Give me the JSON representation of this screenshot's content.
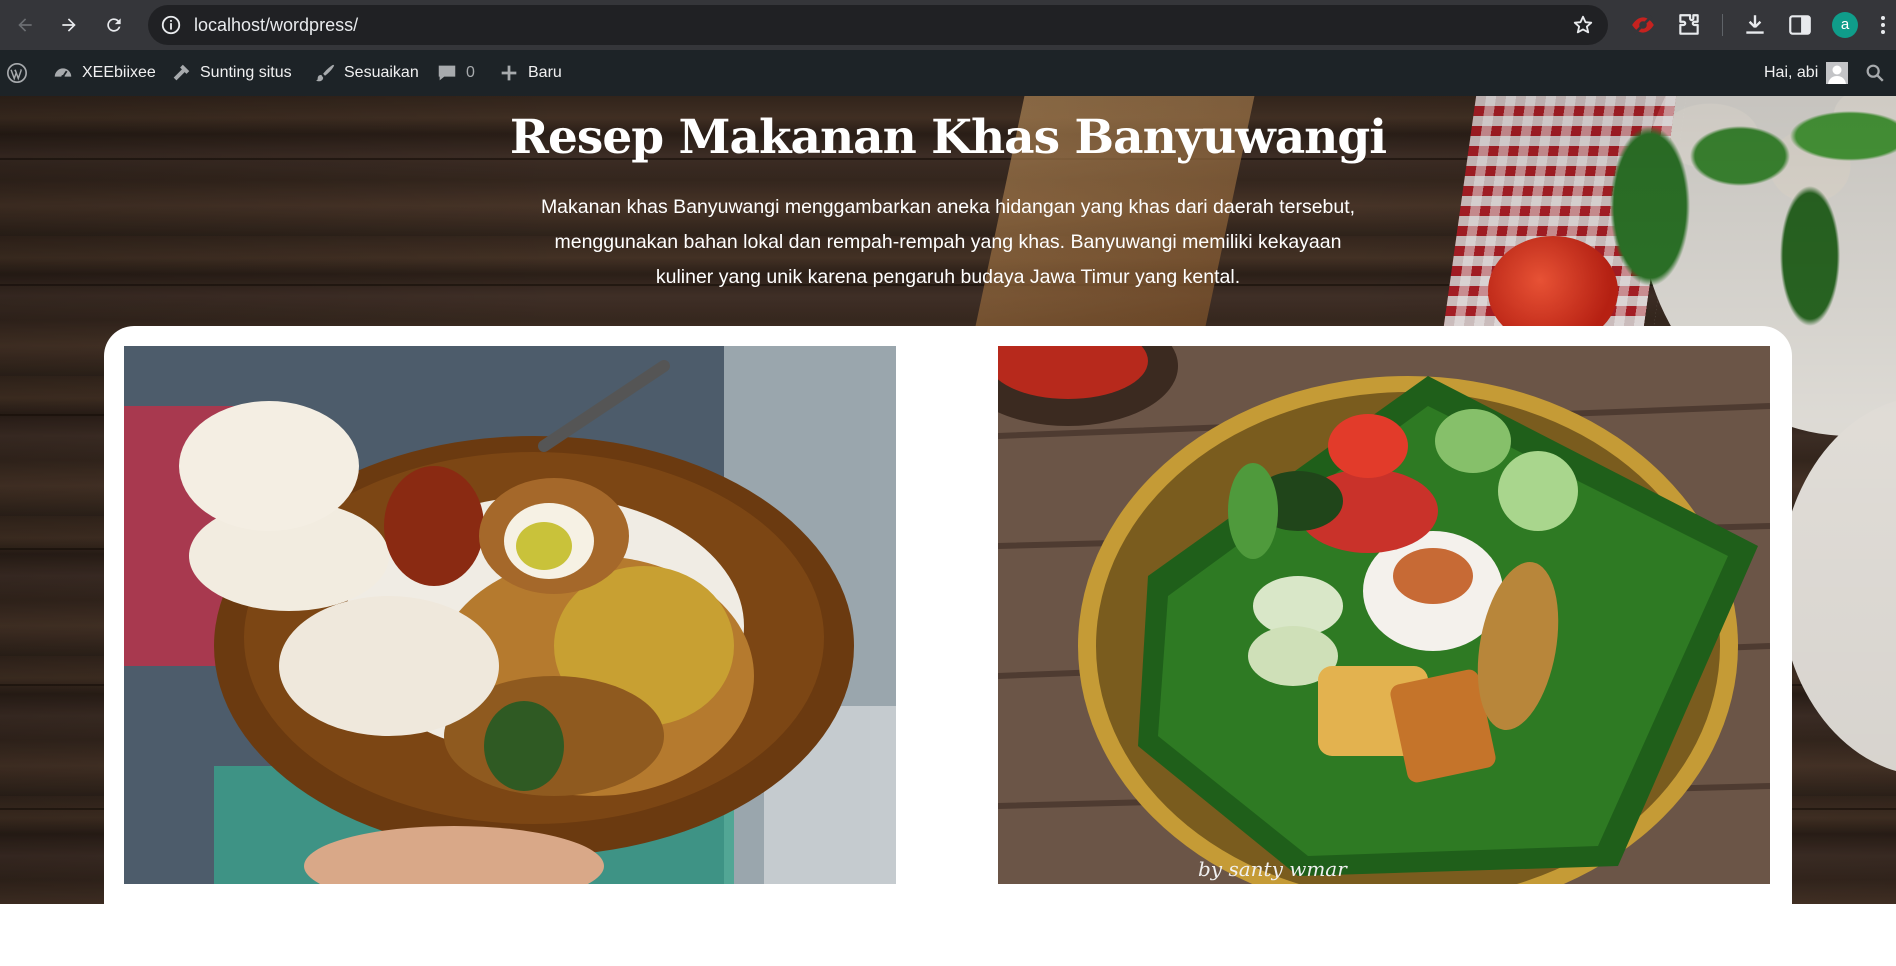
{
  "browser": {
    "url": "localhost/wordpress/",
    "profile_initial": "a"
  },
  "adminbar": {
    "site_name": "XEEbiixee",
    "edit_site": "Sunting situs",
    "customize": "Sesuaikan",
    "comments_count": "0",
    "new": "Baru",
    "greeting": "Hai, abi"
  },
  "hero": {
    "title": "Resep Makanan Khas Banyuwangi",
    "description": "Makanan khas Banyuwangi menggambarkan aneka hidangan yang khas dari daerah tersebut, menggunakan bahan lokal dan rempah-rempah yang khas. Banyuwangi memiliki kekayaan kuliner yang unik karena pengaruh budaya Jawa Timur yang kental."
  },
  "gallery": {
    "watermark": "by santy wmar"
  },
  "colors": {
    "chrome": "#35363a",
    "omnibox": "#202124",
    "adminbar": "#1d2327",
    "avatar": "#0f9d8a"
  }
}
